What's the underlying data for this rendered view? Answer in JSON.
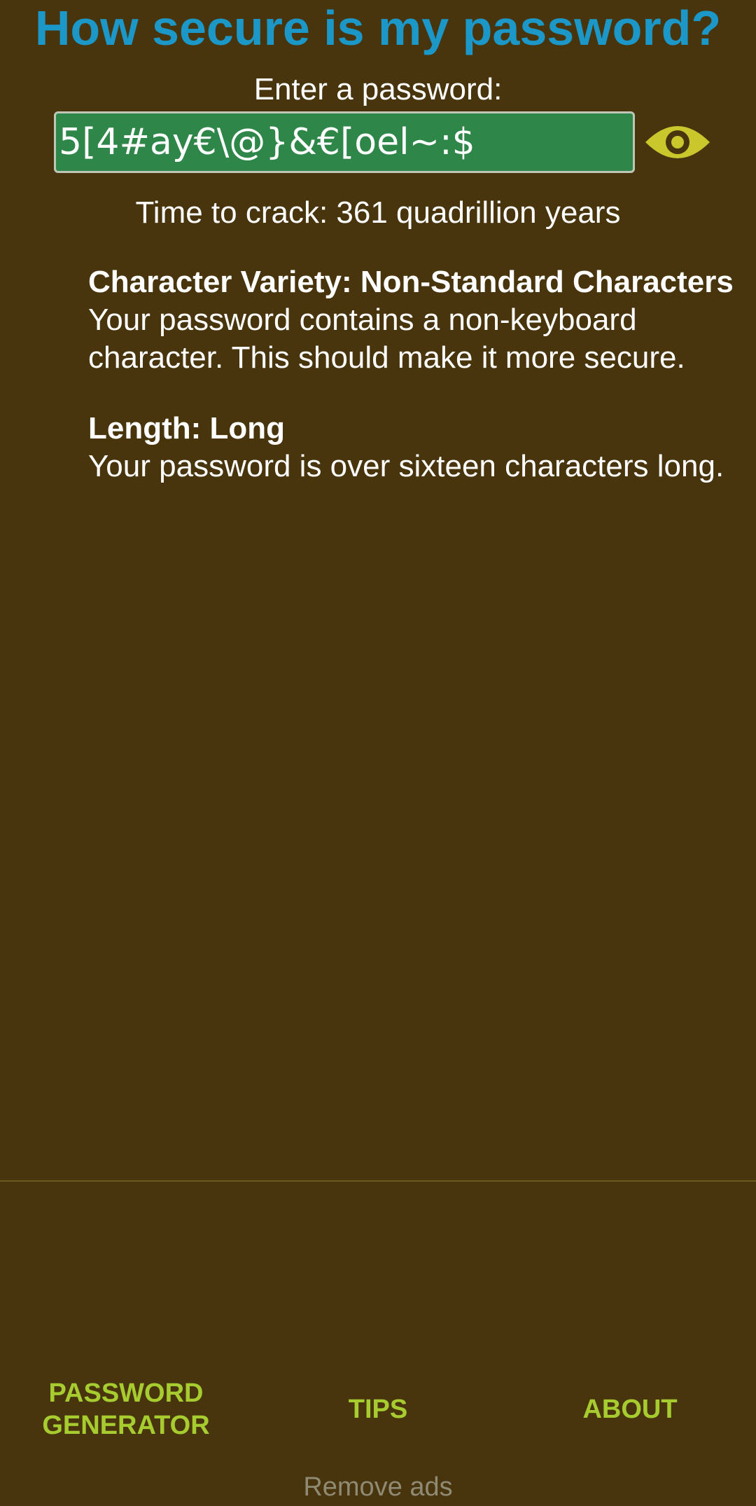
{
  "header": {
    "title": "How secure is my password?"
  },
  "form": {
    "prompt": "Enter a password:",
    "password_value": "5[4#ay€\\@}&€[oel~:$",
    "toggle_icon": "eye-icon"
  },
  "result": {
    "time_to_crack": "Time to crack: 361 quadrillion years"
  },
  "checks": [
    {
      "heading": "Character Variety: Non-Standard Characters",
      "body": "Your password contains a non-keyboard character. This should make it more secure."
    },
    {
      "heading": "Length: Long",
      "body": "Your password is over sixteen characters long."
    }
  ],
  "nav": {
    "generator_line1": "PASSWORD",
    "generator_line2": "GENERATOR",
    "tips": "TIPS",
    "about": "ABOUT"
  },
  "footer": {
    "remove_ads": "Remove ads"
  },
  "colors": {
    "background": "#48350d",
    "title": "#1b97c8",
    "field_background": "#2f8649",
    "eye_icon": "#c9c72c",
    "nav_text": "#a7cc30",
    "muted_text": "#8f8a73"
  }
}
